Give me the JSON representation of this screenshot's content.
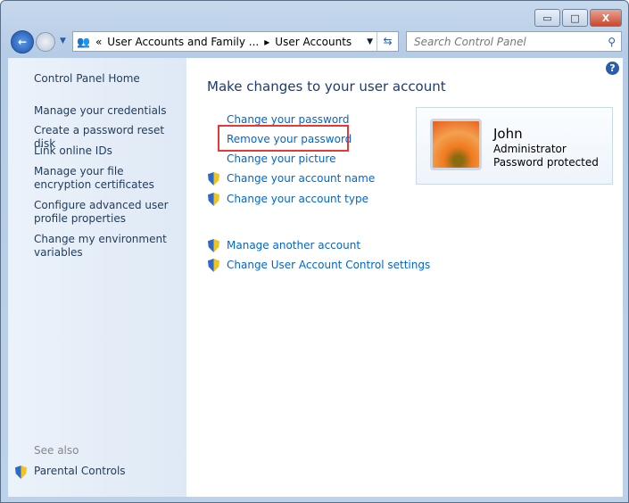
{
  "window": {
    "minimize": "▭",
    "maximize": "□",
    "close": "X"
  },
  "address": {
    "crumbs": [
      "User Accounts and Family ...",
      "User Accounts"
    ],
    "separator": "«",
    "arrow": "▸"
  },
  "search": {
    "placeholder": "Search Control Panel"
  },
  "sidebar": {
    "home": "Control Panel Home",
    "items": [
      "Manage your credentials",
      "Create a password reset disk",
      "Link online IDs",
      "Manage your file encryption certificates",
      "Configure advanced user profile properties",
      "Change my environment variables"
    ],
    "see_also": "See also",
    "parental": "Parental Controls"
  },
  "main": {
    "title": "Make changes to your user account",
    "links": [
      "Change your password",
      "Remove your password",
      "Change your picture",
      "Change your account name",
      "Change your account type"
    ],
    "other": [
      "Manage another account",
      "Change User Account Control settings"
    ]
  },
  "account": {
    "name": "John",
    "role": "Administrator",
    "status": "Password protected"
  },
  "colors": {
    "highlight": "#e53935",
    "link": "#0066cc"
  }
}
